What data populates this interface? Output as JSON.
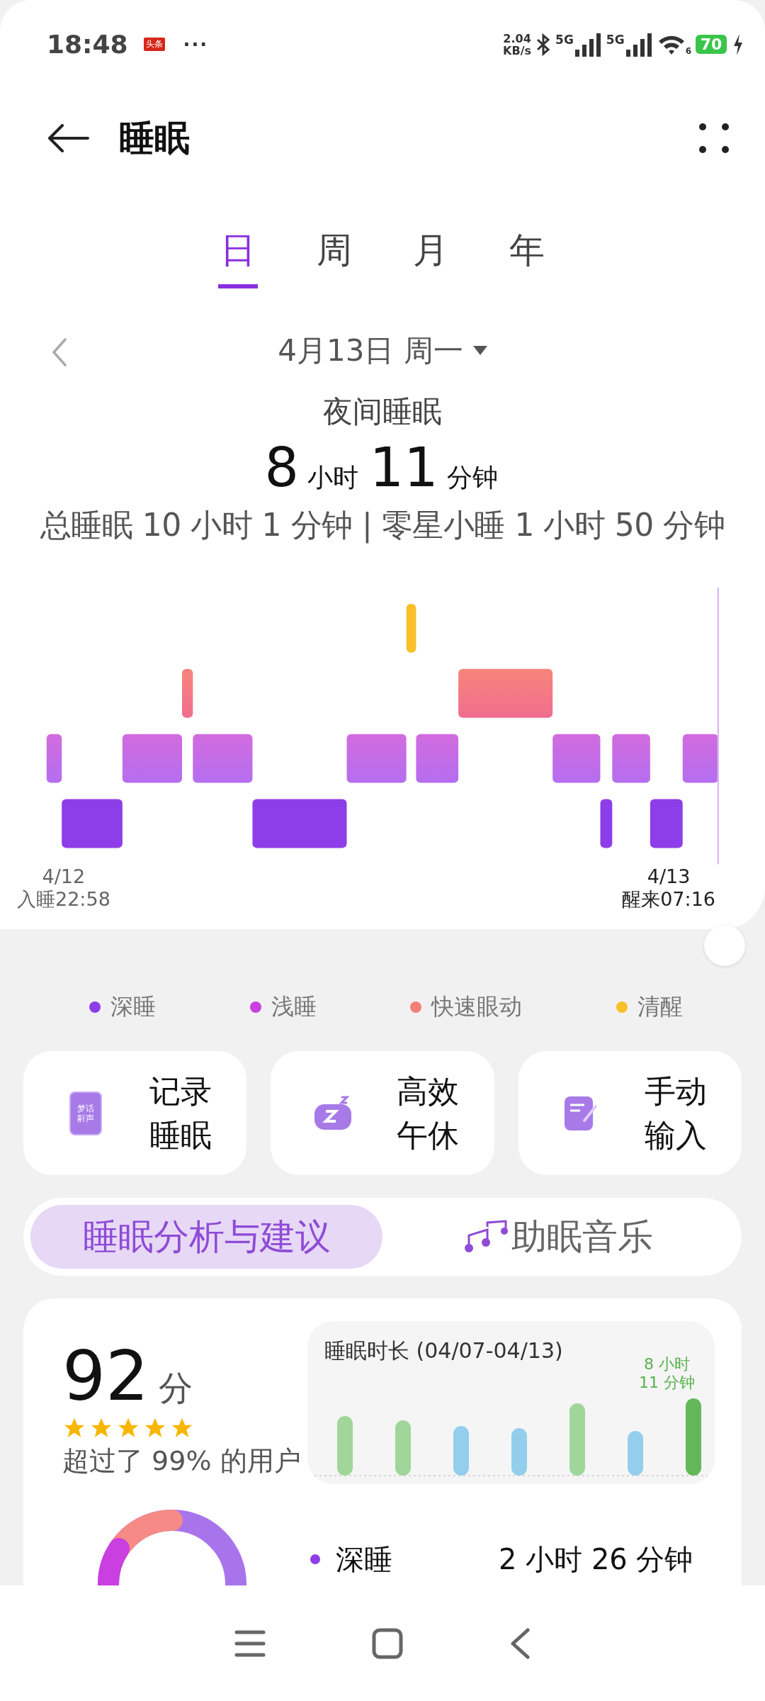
{
  "status_bar": {
    "time": "18:48",
    "notification_badge": "头条",
    "more": "···",
    "net_speed": [
      "2.04",
      "KB/s"
    ],
    "signals": [
      {
        "label": "5G"
      },
      {
        "label": "5G"
      }
    ],
    "wifi_label": "6",
    "battery": "70"
  },
  "header": {
    "title": "睡眠"
  },
  "tabs": [
    {
      "label": "日",
      "selected": true
    },
    {
      "label": "周",
      "selected": false
    },
    {
      "label": "月",
      "selected": false
    },
    {
      "label": "年",
      "selected": false
    }
  ],
  "date": {
    "label": "4月13日 周一"
  },
  "summary": {
    "title": "夜间睡眠",
    "hours": "8",
    "hours_unit": "小时",
    "minutes": "11",
    "minutes_unit": "分钟",
    "detail": "总睡眠 10 小时 1 分钟 | 零星小睡 1 小时 50 分钟"
  },
  "hypnogram": {
    "start_date": "4/12",
    "start_label": "入睡22:58",
    "end_date": "4/13",
    "end_label": "醒来07:16"
  },
  "legend": [
    {
      "label": "深睡",
      "color": "#8e3ee8"
    },
    {
      "label": "浅睡",
      "color": "#c93fe0"
    },
    {
      "label": "快速眼动",
      "color": "#f57f7a"
    },
    {
      "label": "清醒",
      "color": "#f8bf2a"
    }
  ],
  "actions": [
    {
      "kind": "phone",
      "icon_text": [
        "梦话",
        "鼾声"
      ],
      "lines": [
        "记录",
        "睡眠"
      ]
    },
    {
      "kind": "pillow",
      "lines": [
        "高效",
        "午休"
      ]
    },
    {
      "kind": "note",
      "lines": [
        "手动",
        "输入"
      ]
    }
  ],
  "segments": [
    {
      "label": "睡眠分析与建议",
      "selected": true
    },
    {
      "label": "助眠音乐",
      "selected": false,
      "kind": "music"
    }
  ],
  "score": {
    "value": "92",
    "unit": "分",
    "stars": 5,
    "percentile": "超过了 99% 的用户"
  },
  "duration_chart": {
    "title": "睡眠时长 (04/07-04/13)",
    "last_label": [
      "8 小时",
      "11 分钟"
    ]
  },
  "stages": [
    {
      "label": "深睡",
      "color": "#8e3ee8",
      "duration": "2 小时 26 分钟"
    }
  ]
}
